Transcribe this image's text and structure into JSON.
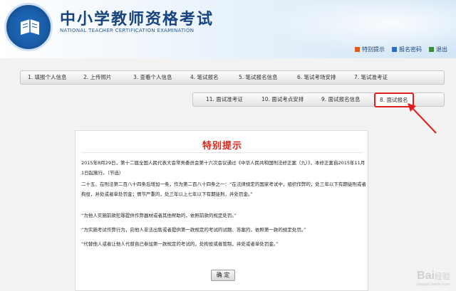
{
  "header": {
    "title": "中小学教师资格考试",
    "subtitle": "NATIONAL TEACHER CERTIFICATION EXAMINATION",
    "links": [
      {
        "label": "特别提示",
        "color": "#e05a1a"
      },
      {
        "label": "报名密码",
        "color": "#2a6fc4"
      },
      {
        "label": "退出",
        "color": "#3b8e3b"
      }
    ]
  },
  "steps_row1": [
    {
      "label": "1. 填报个人信息"
    },
    {
      "label": "2. 上传照片"
    },
    {
      "label": "3. 查看个人信息"
    },
    {
      "label": "4. 笔试报名"
    },
    {
      "label": "5. 笔试报名信息"
    },
    {
      "label": "6. 笔试考场安排"
    },
    {
      "label": "7. 笔试准考证"
    }
  ],
  "steps_row2": [
    {
      "label": "11. 面试准考证"
    },
    {
      "label": "10. 面试考点安排"
    },
    {
      "label": "9. 面试报名信息"
    },
    {
      "label": "8. 面试报名",
      "active": true
    }
  ],
  "notice": {
    "title": "特别提示",
    "paragraphs": [
      "2015年8月29日，第十二届全国人民代表大会常务委员会第十六次会议通过《中华人民共和国刑法修正案（九）》，本修正案自2015年11月1日起施行。（节选）",
      "二十五、在刑法第二百八十四条后增加一条，作为第二百八十四条之一：“在法律规定的国家考试中，组织作弊的，处三年以下有期徒刑或者拘役，并处或者单处罚金；情节严重的，处三年以上七年以下有期徒刑，并处罚金。”",
      "“为他人实施前款犯罪提供作弊器材或者其他帮助的，依照前款的规定处罚。”",
      "“为实施考试作弊行为，向他人非法出售或者提供第一款规定的考试的试题、答案的，依照第一款的规定处罚。”",
      "“代替他人或者让他人代替自己参加第一款规定的考试的，处拘役或者管制，并处或者单处罚金。”"
    ],
    "confirm_label": "确 定"
  },
  "watermark": {
    "logo": "Bai",
    "text": "经验",
    "sub": "jingyan.baidu.com"
  },
  "colors": {
    "accent": "#d8261b",
    "brand": "#17447e",
    "highlight": "#e02020"
  }
}
